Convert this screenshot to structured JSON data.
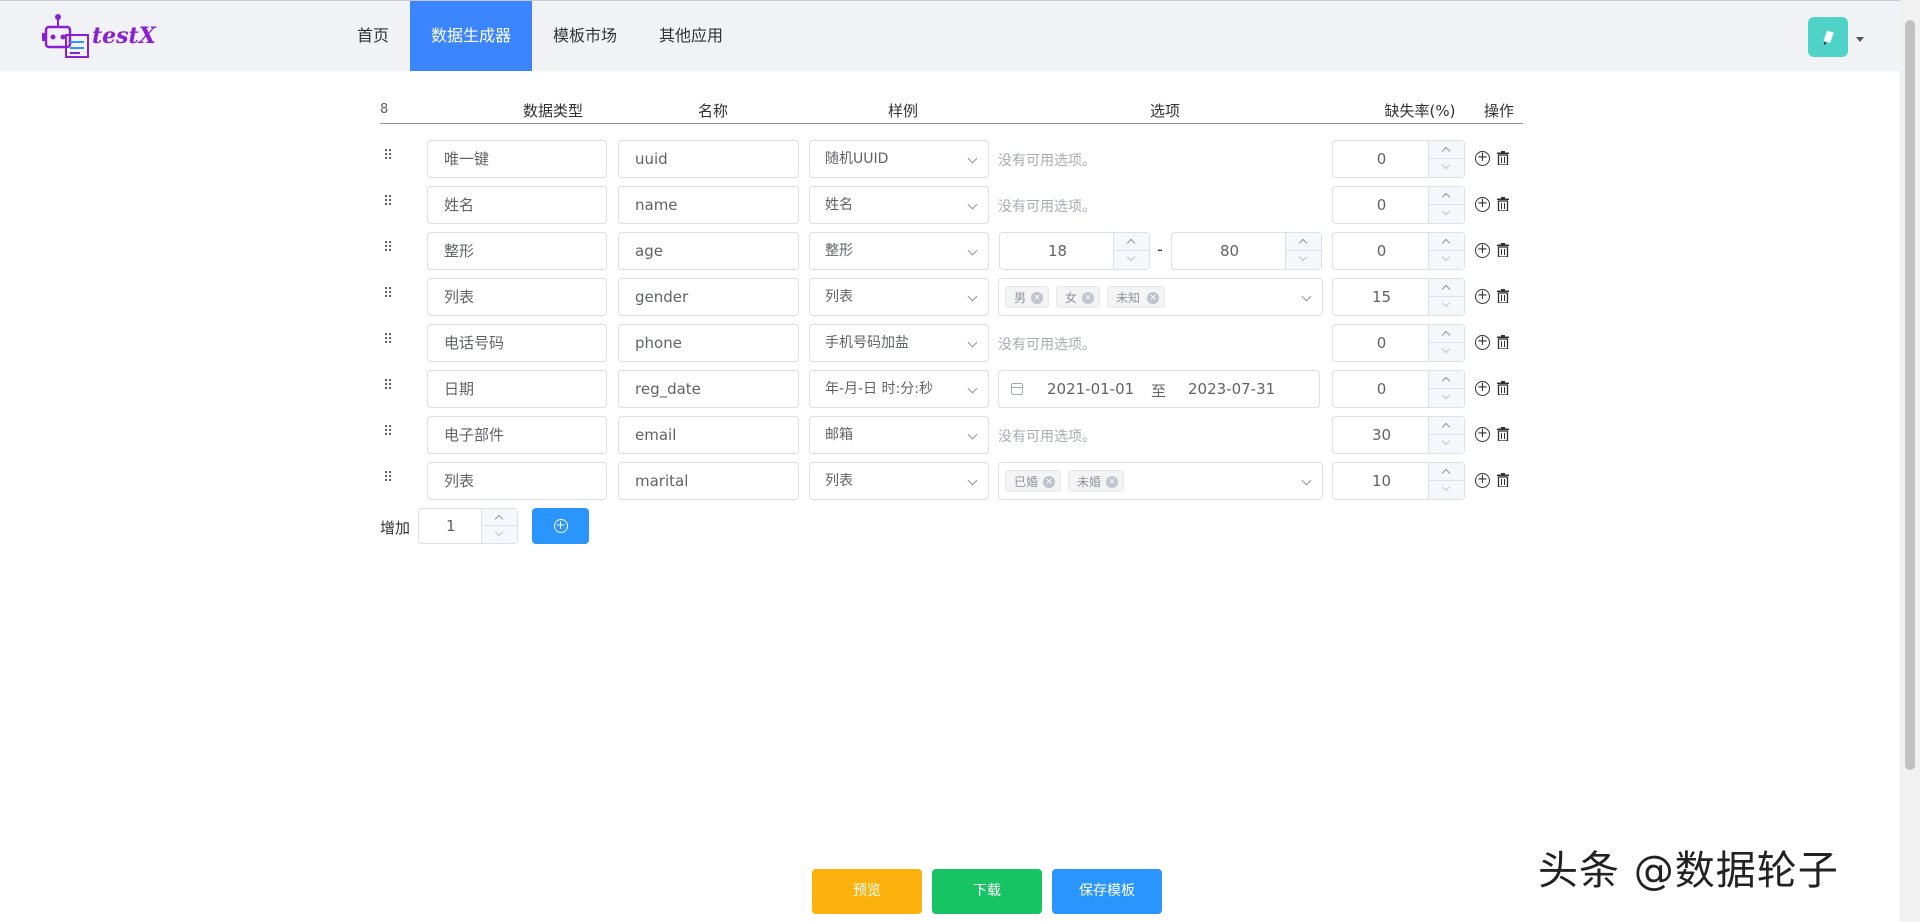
{
  "app": {
    "logo_text": "testX"
  },
  "nav": {
    "items": [
      {
        "label": "首页",
        "active": false
      },
      {
        "label": "数据生成器",
        "active": true
      },
      {
        "label": "模板市场",
        "active": false
      },
      {
        "label": "其他应用",
        "active": false
      }
    ]
  },
  "table": {
    "count": "8",
    "headers": {
      "type": "数据类型",
      "name": "名称",
      "sample": "样例",
      "options": "选项",
      "missing": "缺失率(%)",
      "actions": "操作"
    },
    "no_options_text": "没有可用选项。",
    "rows": [
      {
        "type": "唯一键",
        "name": "uuid",
        "sample": "随机UUID",
        "missing": "0"
      },
      {
        "type": "姓名",
        "name": "name",
        "sample": "姓名",
        "missing": "0"
      },
      {
        "type": "整形",
        "name": "age",
        "sample": "整形",
        "min": "18",
        "max": "80",
        "missing": "0"
      },
      {
        "type": "列表",
        "name": "gender",
        "sample": "列表",
        "tags": [
          "男",
          "女",
          "未知"
        ],
        "missing": "15"
      },
      {
        "type": "电话号码",
        "name": "phone",
        "sample": "手机号码加盐",
        "missing": "0"
      },
      {
        "type": "日期",
        "name": "reg_date",
        "sample": "年-月-日 时:分:秒",
        "date_start": "2021-01-01",
        "date_sep": "至",
        "date_end": "2023-07-31",
        "missing": "0"
      },
      {
        "type": "电子部件",
        "name": "email",
        "sample": "邮箱",
        "missing": "30"
      },
      {
        "type": "列表",
        "name": "marital",
        "sample": "列表",
        "tags": [
          "已婚",
          "未婚"
        ],
        "missing": "10"
      }
    ]
  },
  "add": {
    "label": "增加",
    "value": "1"
  },
  "buttons": {
    "preview": "预览",
    "download": "下载",
    "save": "保存模板"
  },
  "watermark": "头条 @数据轮子",
  "colors": {
    "primary": "#3b86ff",
    "preview": "#fcb20e",
    "download": "#16c464",
    "save": "#2b95ff"
  }
}
